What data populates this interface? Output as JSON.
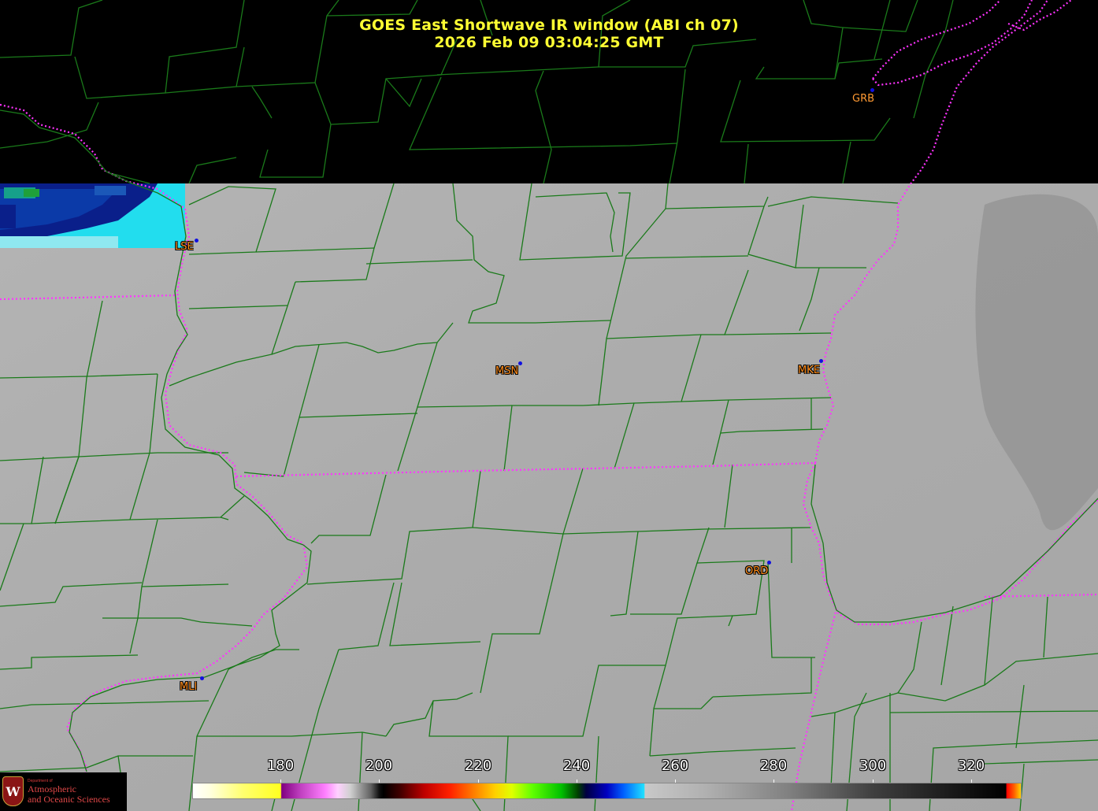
{
  "title": {
    "line1": "GOES East Shortwave IR window (ABI ch 07)",
    "line2": "2026 Feb 09  03:04:25 GMT"
  },
  "stations": [
    {
      "id": "GRB",
      "label": "GRB"
    },
    {
      "id": "LSE",
      "label": "LSE"
    },
    {
      "id": "MSN",
      "label": "MSN"
    },
    {
      "id": "MKE",
      "label": "MKE"
    },
    {
      "id": "ORD",
      "label": "ORD"
    },
    {
      "id": "MLI",
      "label": "MLI"
    }
  ],
  "colorbar": {
    "ticks": [
      "180",
      "200",
      "220",
      "240",
      "260",
      "280",
      "300",
      "320"
    ]
  },
  "logo": {
    "department": "Department of",
    "line1": "Atmospheric",
    "line2": "and Oceanic Sciences"
  },
  "colors": {
    "title": "#ffff33",
    "county_lines": "#1a7a1a",
    "state_lines": "#ff33ff",
    "station_label": "#ff8c1a",
    "station_dot": "#1010e0"
  }
}
